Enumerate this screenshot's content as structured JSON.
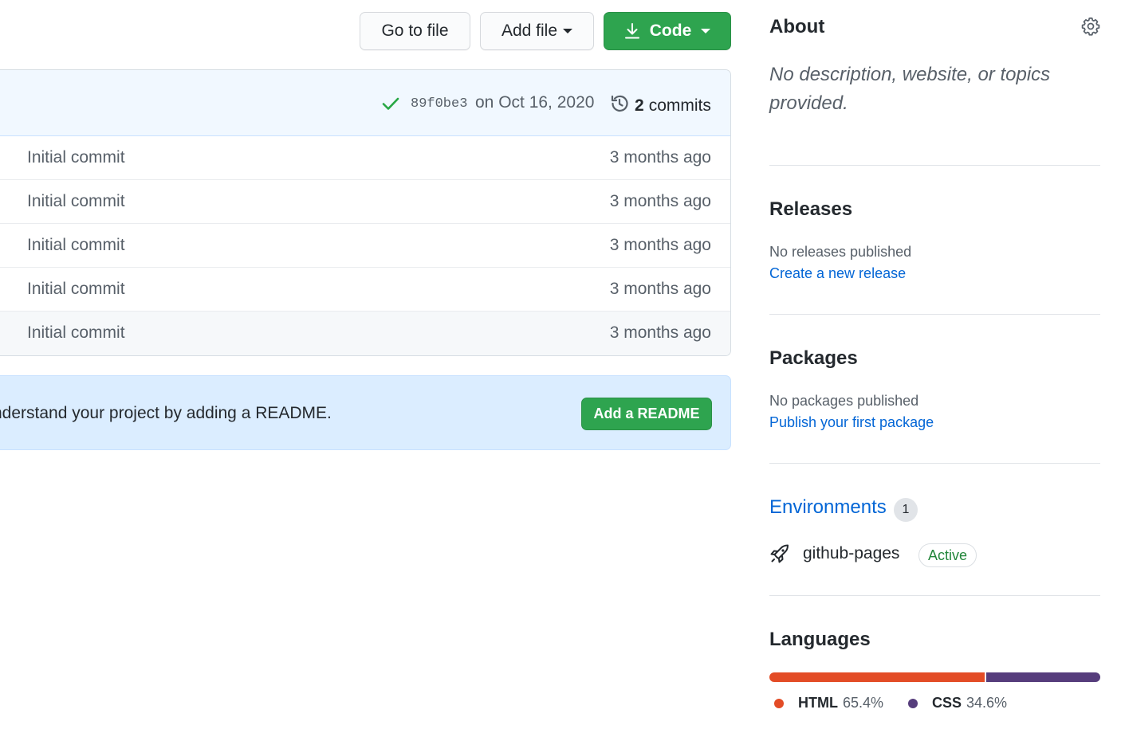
{
  "toolbar": {
    "goto_label": "Go to file",
    "addfile_label": "Add file",
    "code_label": "Code"
  },
  "commit": {
    "sha": "89f0be3",
    "date": "on Oct 16, 2020",
    "count": "2",
    "count_label": "commits"
  },
  "files": [
    {
      "message": "Initial commit",
      "age": "3 months ago"
    },
    {
      "message": "Initial commit",
      "age": "3 months ago"
    },
    {
      "message": "Initial commit",
      "age": "3 months ago"
    },
    {
      "message": "Initial commit",
      "age": "3 months ago"
    },
    {
      "message": "Initial commit",
      "age": "3 months ago"
    }
  ],
  "readme": {
    "text": "nderstand your project by adding a README.",
    "button": "Add a README"
  },
  "sidebar": {
    "about_title": "About",
    "about_desc": "No description, website, or topics provided.",
    "releases_title": "Releases",
    "releases_none": "No releases published",
    "releases_link": "Create a new release",
    "packages_title": "Packages",
    "packages_none": "No packages published",
    "packages_link": "Publish your first package",
    "environments_title": "Environments",
    "environments_count": "1",
    "environment_name": "github-pages",
    "environment_status": "Active",
    "languages_title": "Languages",
    "languages": [
      {
        "name": "HTML",
        "percent": "65.4%",
        "value": 65.4,
        "color": "#e34c26"
      },
      {
        "name": "CSS",
        "percent": "34.6%",
        "value": 34.6,
        "color": "#563d7c"
      }
    ]
  },
  "colors": {
    "green_button": "#2ea44f",
    "link_blue": "#0366d6",
    "commit_bar_bg": "#f1f8ff",
    "readme_bg": "#dbedff"
  }
}
